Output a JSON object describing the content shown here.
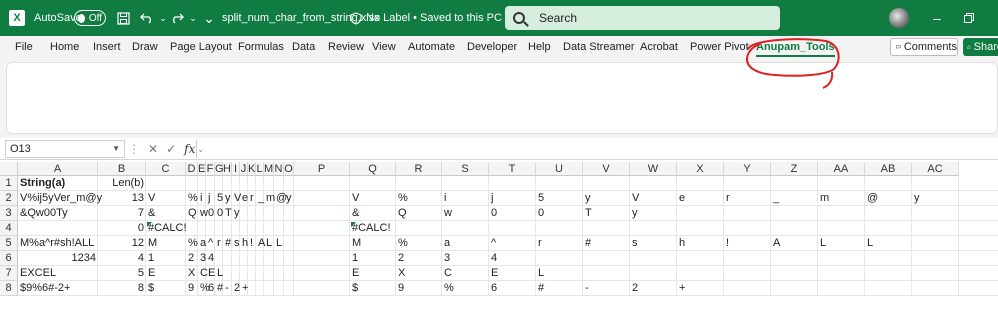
{
  "titlebar": {
    "autosave_label": "AutoSave",
    "autosave_state": "Off",
    "filename": "split_num_char_from_string.xlsx",
    "label_status": "No Label • Saved to this PC",
    "search_placeholder": "Search"
  },
  "ribbon": {
    "tabs": [
      "File",
      "Home",
      "Insert",
      "Draw",
      "Page Layout",
      "Formulas",
      "Data",
      "Review",
      "View",
      "Automate",
      "Developer",
      "Help",
      "Data Streamer",
      "Acrobat",
      "Power Pivot",
      "Anupam_Tools"
    ],
    "active_tab": "Anupam_Tools",
    "comments_label": "Comments",
    "share_label": "Share",
    "accent_color": "#107c41",
    "annotation_color": "#e02020"
  },
  "formula_bar": {
    "name_box": "O13",
    "fx_label": "fx",
    "formula": ""
  },
  "sheet": {
    "columns": [
      "A",
      "B",
      "C",
      "D",
      "E",
      "F",
      "G",
      "H",
      "I",
      "J",
      "K",
      "L",
      "M",
      "N",
      "O",
      "P",
      "Q",
      "R",
      "S",
      "T",
      "U",
      "V",
      "W",
      "X",
      "Y",
      "Z",
      "AA",
      "AB",
      "AC"
    ],
    "rows": [
      "1",
      "2",
      "3",
      "4",
      "5",
      "6",
      "7",
      "8"
    ],
    "cells": {
      "r1": {
        "A": "String(a)",
        "B": "Len(b)"
      },
      "r2": {
        "A": "V%ij5yVer_m@y",
        "B": "13",
        "C": "V",
        "D": "%",
        "E": "i",
        "F": "j",
        "G": "5",
        "H": "y",
        "I": "V",
        "J": "e",
        "K": "r",
        "L": "_",
        "M": "m",
        "N": "@",
        "O": "y",
        "Q": "V",
        "R": "%",
        "S": "i",
        "T": "j",
        "U": "5",
        "V": "y",
        "W": "V",
        "X": "e",
        "Y": "r",
        "Z": "_",
        "AA": "m",
        "AB": "@",
        "AC": "y"
      },
      "r3": {
        "A": "&Qw00Ty",
        "B": "7",
        "C": "&",
        "D": "Q",
        "E": "w",
        "F": "0",
        "G": "0",
        "H": "T",
        "I": "y",
        "Q": "&",
        "R": "Q",
        "S": "w",
        "T": "0",
        "U": "0",
        "V": "T",
        "W": "y"
      },
      "r4": {
        "B": "0",
        "C": "#CALC!",
        "Q": "#CALC!"
      },
      "r5": {
        "A": "M%a^r#sh!ALL",
        "B": "12",
        "C": "M",
        "D": "%",
        "E": "a",
        "F": "^",
        "G": "r",
        "H": "#",
        "I": "s",
        "J": "h",
        "K": "!",
        "L": "A",
        "M": "L",
        "N": "L",
        "Q": "M",
        "R": "%",
        "S": "a",
        "T": "^",
        "U": "r",
        "V": "#",
        "W": "s",
        "X": "h",
        "Y": "!",
        "Z": "A",
        "AA": "L",
        "AB": "L"
      },
      "r6": {
        "A": "1234",
        "B": "4",
        "C": "1",
        "D": "2",
        "E": "3",
        "F": "4",
        "Q": "1",
        "R": "2",
        "S": "3",
        "T": "4"
      },
      "r7": {
        "A": "EXCEL",
        "B": "5",
        "C": "E",
        "D": "X",
        "E": "C",
        "F": "E",
        "G": "L",
        "Q": "E",
        "R": "X",
        "S": "C",
        "T": "E",
        "U": "L"
      },
      "r8": {
        "A": "$9%6#-2+",
        "B": "8",
        "C": "$",
        "D": "9",
        "E": "%",
        "F": "6",
        "G": "#",
        "H": "-",
        "I": "2",
        "J": "+",
        "Q": "$",
        "R": "9",
        "S": "%",
        "T": "6",
        "U": "#",
        "V": "-",
        "W": "2",
        "X": "+"
      }
    }
  }
}
